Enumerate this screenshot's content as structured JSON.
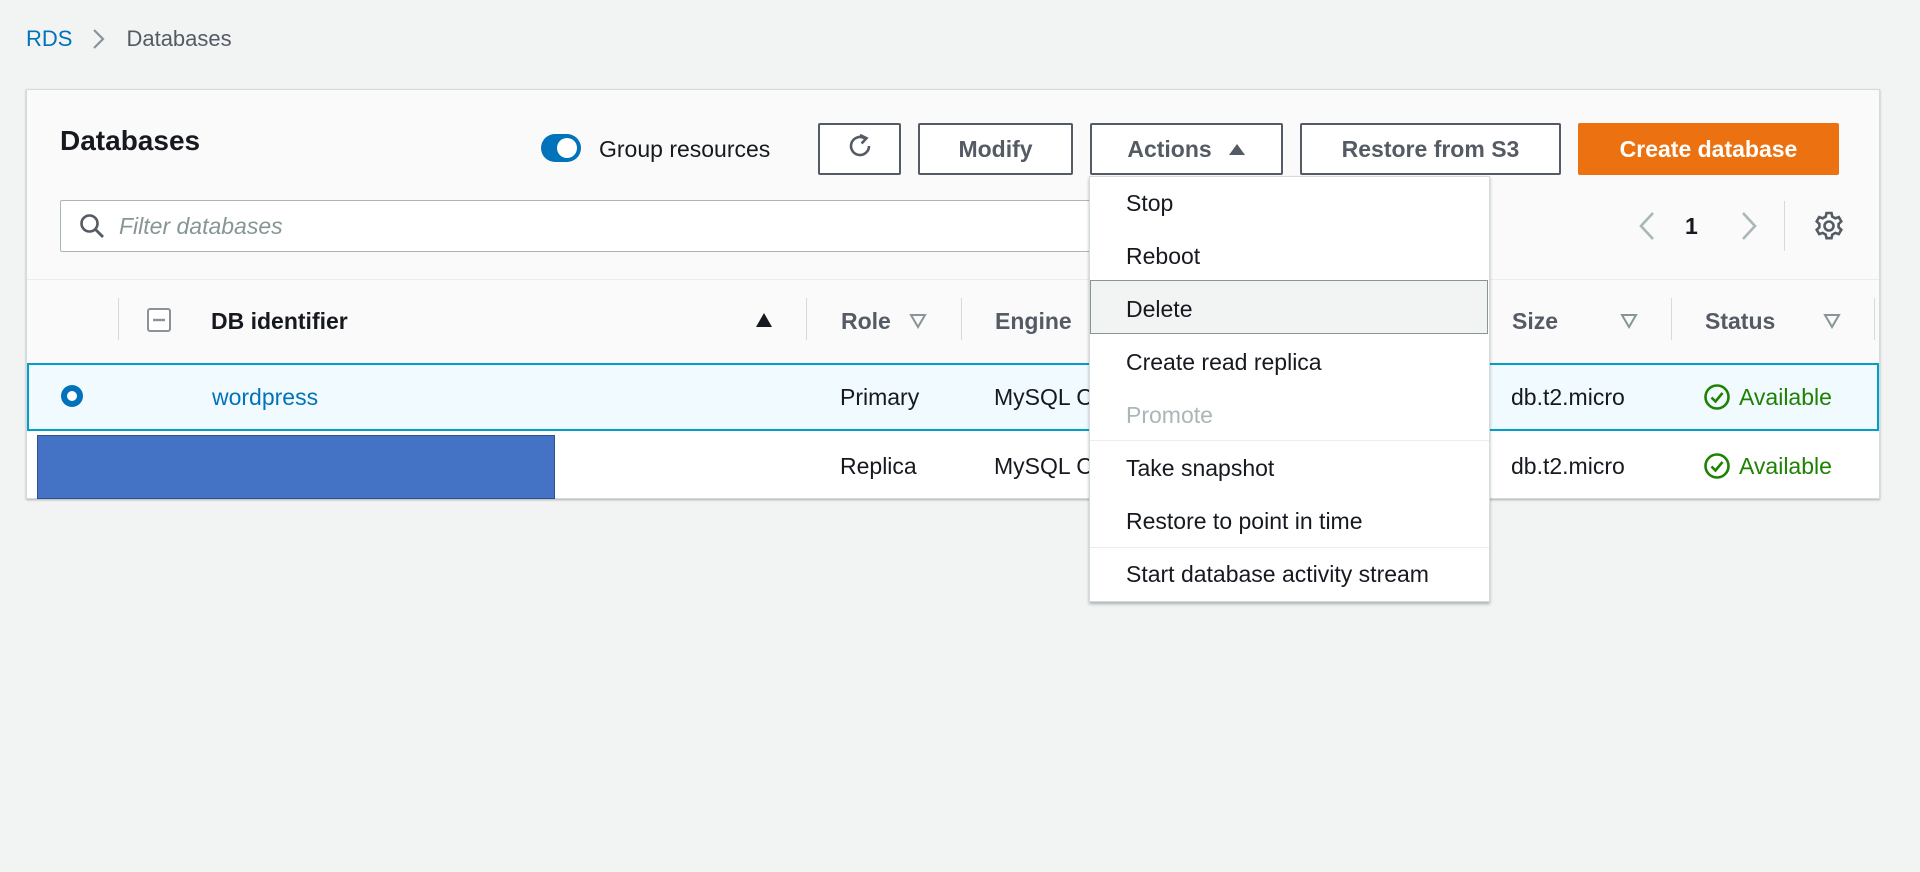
{
  "breadcrumb": {
    "root": "RDS",
    "current": "Databases"
  },
  "header": {
    "title": "Databases",
    "group_resources_label": "Group resources",
    "group_resources_on": true,
    "modify_label": "Modify",
    "actions_label": "Actions",
    "restore_s3_label": "Restore from S3",
    "create_label": "Create database",
    "accent_color": "#ec7211"
  },
  "search": {
    "placeholder": "Filter databases"
  },
  "pagination": {
    "page": "1"
  },
  "table": {
    "columns": {
      "db_identifier": "DB identifier",
      "role": "Role",
      "engine": "Engine",
      "size": "Size",
      "status": "Status"
    },
    "rows": [
      {
        "identifier": "wordpress",
        "role": "Primary",
        "engine": "MySQL C",
        "size": "db.t2.micro",
        "status": "Available",
        "selected": true
      },
      {
        "identifier": "",
        "role": "Replica",
        "engine": "MySQL C",
        "size": "db.t2.micro",
        "status": "Available",
        "selected": false
      }
    ]
  },
  "actions_menu": {
    "items": [
      {
        "label": "Stop",
        "disabled": false
      },
      {
        "label": "Reboot",
        "disabled": false
      },
      {
        "label": "Delete",
        "disabled": false,
        "highlighted": true
      },
      {
        "label": "Create read replica",
        "disabled": false
      },
      {
        "label": "Promote",
        "disabled": true
      },
      {
        "label": "Take snapshot",
        "disabled": false
      },
      {
        "label": "Restore to point in time",
        "disabled": false
      },
      {
        "label": "Start database activity stream",
        "disabled": false
      }
    ]
  },
  "colors": {
    "link": "#0073bb",
    "success": "#1d8102",
    "selection_border": "#00a1c9"
  }
}
